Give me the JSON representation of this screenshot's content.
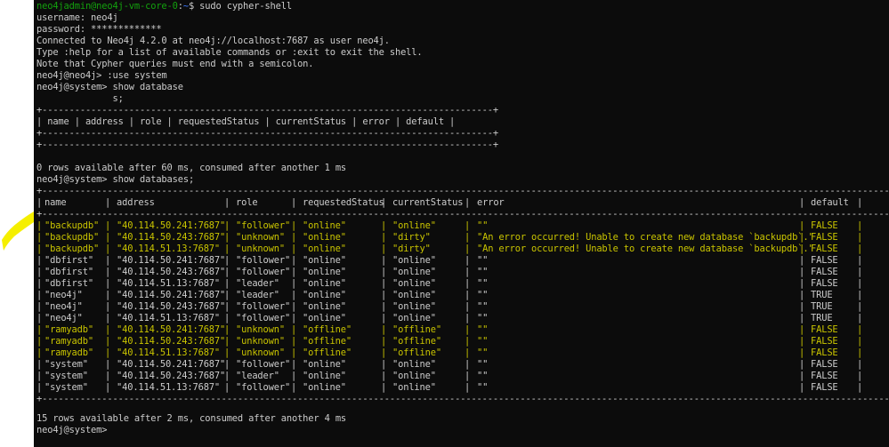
{
  "lines": {
    "l1_user": "neo4jadmin@neo4j-vm-core-0",
    "l1_colon": ":",
    "l1_path": "~",
    "l1_cmd": "$ sudo cypher-shell",
    "l2": "username: neo4j",
    "l3": "password: *************",
    "l4": "Connected to Neo4j 4.2.0 at neo4j://localhost:7687 as user neo4j.",
    "l5": "Type :help for a list of available commands or :exit to exit the shell.",
    "l6": "Note that Cypher queries must end with a semicolon.",
    "l7": "neo4j@neo4j> :use system",
    "l8": "neo4j@system> show database",
    "l9": "              s;",
    "t1_border": "+-----------------------------------------------------------------------------------+",
    "t1_header": "| name | address | role | requestedStatus | currentStatus | error | default |",
    "t1_border2": "+-----------------------------------------------------------------------------------+",
    "t1_border3": "+-----------------------------------------------------------------------------------+",
    "r1": "0 rows available after 60 ms, consumed after another 1 ms",
    "l10": "neo4j@system> show databases;",
    "t2_top": "+---------------------------------------------------------------------------------------------------------------------------------------------------------------------------------------+",
    "t2_sep": "+---------------------------------------------------------------------------------------------------------------------------------------------------------------------------------------+",
    "r2": "15 rows available after 2 ms, consumed after another 4 ms",
    "l_last": "neo4j@system>"
  },
  "table": {
    "headers": [
      "name",
      "address",
      "role",
      "requestedStatus",
      "currentStatus",
      "error",
      "default"
    ],
    "rows": [
      {
        "name": "\"backupdb\"",
        "address": "\"40.114.50.241:7687\"",
        "role": "\"follower\"",
        "requested": "\"online\"",
        "current": "\"online\"",
        "error": "\"\"",
        "default": "FALSE",
        "hl": true
      },
      {
        "name": "\"backupdb\"",
        "address": "\"40.114.50.243:7687\"",
        "role": "\"unknown\"",
        "requested": "\"online\"",
        "current": "\"dirty\"",
        "error": "\"An error occurred! Unable to create new database `backupdb`.\"",
        "default": "FALSE",
        "hl": true
      },
      {
        "name": "\"backupdb\"",
        "address": "\"40.114.51.13:7687\"",
        "role": "\"unknown\"",
        "requested": "\"online\"",
        "current": "\"dirty\"",
        "error": "\"An error occurred! Unable to create new database `backupdb`.\"",
        "default": "FALSE",
        "hl": true
      },
      {
        "name": "\"dbfirst\"",
        "address": "\"40.114.50.241:7687\"",
        "role": "\"follower\"",
        "requested": "\"online\"",
        "current": "\"online\"",
        "error": "\"\"",
        "default": "FALSE",
        "hl": false
      },
      {
        "name": "\"dbfirst\"",
        "address": "\"40.114.50.243:7687\"",
        "role": "\"follower\"",
        "requested": "\"online\"",
        "current": "\"online\"",
        "error": "\"\"",
        "default": "FALSE",
        "hl": false
      },
      {
        "name": "\"dbfirst\"",
        "address": "\"40.114.51.13:7687\"",
        "role": "\"leader\"",
        "requested": "\"online\"",
        "current": "\"online\"",
        "error": "\"\"",
        "default": "FALSE",
        "hl": false
      },
      {
        "name": "\"neo4j\"",
        "address": "\"40.114.50.241:7687\"",
        "role": "\"leader\"",
        "requested": "\"online\"",
        "current": "\"online\"",
        "error": "\"\"",
        "default": "TRUE",
        "hl": false
      },
      {
        "name": "\"neo4j\"",
        "address": "\"40.114.50.243:7687\"",
        "role": "\"follower\"",
        "requested": "\"online\"",
        "current": "\"online\"",
        "error": "\"\"",
        "default": "TRUE",
        "hl": false
      },
      {
        "name": "\"neo4j\"",
        "address": "\"40.114.51.13:7687\"",
        "role": "\"follower\"",
        "requested": "\"online\"",
        "current": "\"online\"",
        "error": "\"\"",
        "default": "TRUE",
        "hl": false
      },
      {
        "name": "\"ramyadb\"",
        "address": "\"40.114.50.241:7687\"",
        "role": "\"unknown\"",
        "requested": "\"offline\"",
        "current": "\"offline\"",
        "error": "\"\"",
        "default": "FALSE",
        "hl": true
      },
      {
        "name": "\"ramyadb\"",
        "address": "\"40.114.50.243:7687\"",
        "role": "\"unknown\"",
        "requested": "\"offline\"",
        "current": "\"offline\"",
        "error": "\"\"",
        "default": "FALSE",
        "hl": true
      },
      {
        "name": "\"ramyadb\"",
        "address": "\"40.114.51.13:7687\"",
        "role": "\"unknown\"",
        "requested": "\"offline\"",
        "current": "\"offline\"",
        "error": "\"\"",
        "default": "FALSE",
        "hl": true
      },
      {
        "name": "\"system\"",
        "address": "\"40.114.50.241:7687\"",
        "role": "\"follower\"",
        "requested": "\"online\"",
        "current": "\"online\"",
        "error": "\"\"",
        "default": "FALSE",
        "hl": false
      },
      {
        "name": "\"system\"",
        "address": "\"40.114.50.243:7687\"",
        "role": "\"leader\"",
        "requested": "\"online\"",
        "current": "\"online\"",
        "error": "\"\"",
        "default": "FALSE",
        "hl": false
      },
      {
        "name": "\"system\"",
        "address": "\"40.114.51.13:7687\"",
        "role": "\"follower\"",
        "requested": "\"online\"",
        "current": "\"online\"",
        "error": "\"\"",
        "default": "FALSE",
        "hl": false
      }
    ]
  },
  "colors": {
    "background": "#0c0c0c",
    "text": "#cccccc",
    "prompt_user": "#13a10e",
    "prompt_path": "#3b78ff",
    "highlight": "#ffff00"
  }
}
